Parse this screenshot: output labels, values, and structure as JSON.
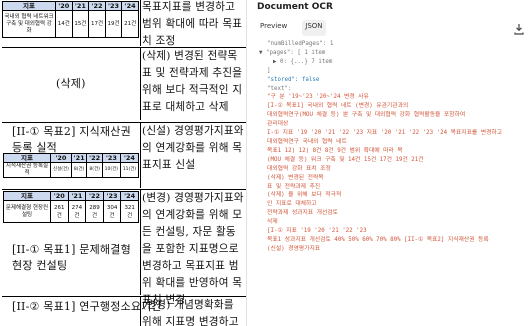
{
  "document": {
    "header_cell": "지표",
    "years": [
      "'20",
      "'21",
      "'22",
      "'23",
      "'24"
    ],
    "top_table": {
      "label": "국내외 협력 네트워크 구축 및 대외협력 강화",
      "values": [
        "14건",
        "15건",
        "17건",
        "19건",
        "21건"
      ]
    },
    "rows": [
      {
        "left": "",
        "right": "목표지표를 변경하고 범위 확대에 따라 목표치 조정"
      },
      {
        "left": "(삭제)",
        "right": "(삭제) 변경된 전략목표 및 전략과제 추진을 위해 보다 적극적인 지표로 대체하고 삭제"
      },
      {
        "left": "[II-① 목표2] 지식재산권 등록 실적",
        "right": "(신설) 경영평가지표와의 연계강화를 위해 목표지표 신설"
      },
      {
        "left": "[II-① 목표1] 문제해결형 현장 컨설팅",
        "right": "(변경) 경영평가지표와의 연계강화를 위해 모든 컨설팅, 자문 활동을 포함한 지표명으로 변경하고 목표지표 범위 확대를 반영하여 목표치 변경"
      },
      {
        "left": "[II-② 목표1] 연구행정소요기간",
        "right": "(변경) 개념명확화를 위해 지표명 변경하고"
      }
    ],
    "ip_table": {
      "label": "지적재산권 등록실적",
      "values": [
        "신설(건)",
        "8(건)",
        "8(건)",
        "10(건)",
        "11(건)"
      ]
    },
    "consult_table": {
      "label": "문제해결형 현장컨설팅",
      "values": [
        "261건",
        "274건",
        "289건",
        "304건",
        "321건"
      ]
    }
  },
  "ocr": {
    "title": "Document OCR",
    "tabs": [
      "Preview",
      "JSON"
    ],
    "active_tab": "JSON",
    "download_icon": "download-icon",
    "json_lines": [
      "\"numBilledPages\": 1",
      "\"pages\": [ 1 item",
      "0: {...} 7 item",
      "]",
      "\"stored\": false",
      "\"text\":"
    ],
    "text_lines": [
      "\"구 분 '19~'23 '20~'24 변경 사유",
      "[I-① 목표1] 국내외 협력 네트 (변경) 유관기관과의",
      "대외협력연구(MOU 체결 등) 뿐 구축 및 대외협력 강화 협력활동을 포함하여",
      "관리대상",
      "I-① 지표 '19 '20 '21 '22 '23 지표 '20 '21 '22 '23 '24 목표지표를 변경하고",
      "",
      "대외협력연구 국내외 협력 네트",
      "목표1 12) 12) 8건 8건 9건 범위 확대에 따라 목",
      "(MOU 체결 등) 워크 구축 및 14건 15건 17건 19건 21건",
      "대외협력 강화 표치 조정",
      "(삭제) 변경된 전략목",
      "표 및 전략과제 추진",
      "(삭제) 을 위해 보다 적극적",
      "인 지표로 대체하고",
      "전략과제 성과지표 개선검토",
      "삭제",
      "[I-① 지표 '19 '20 '21 '22 '23",
      "목표1 성과지표 개선검토 40% 50% 60% 70% 80% [II-① 목표2] 지식재산권 등록",
      "(신설) 경영평가지표"
    ]
  }
}
